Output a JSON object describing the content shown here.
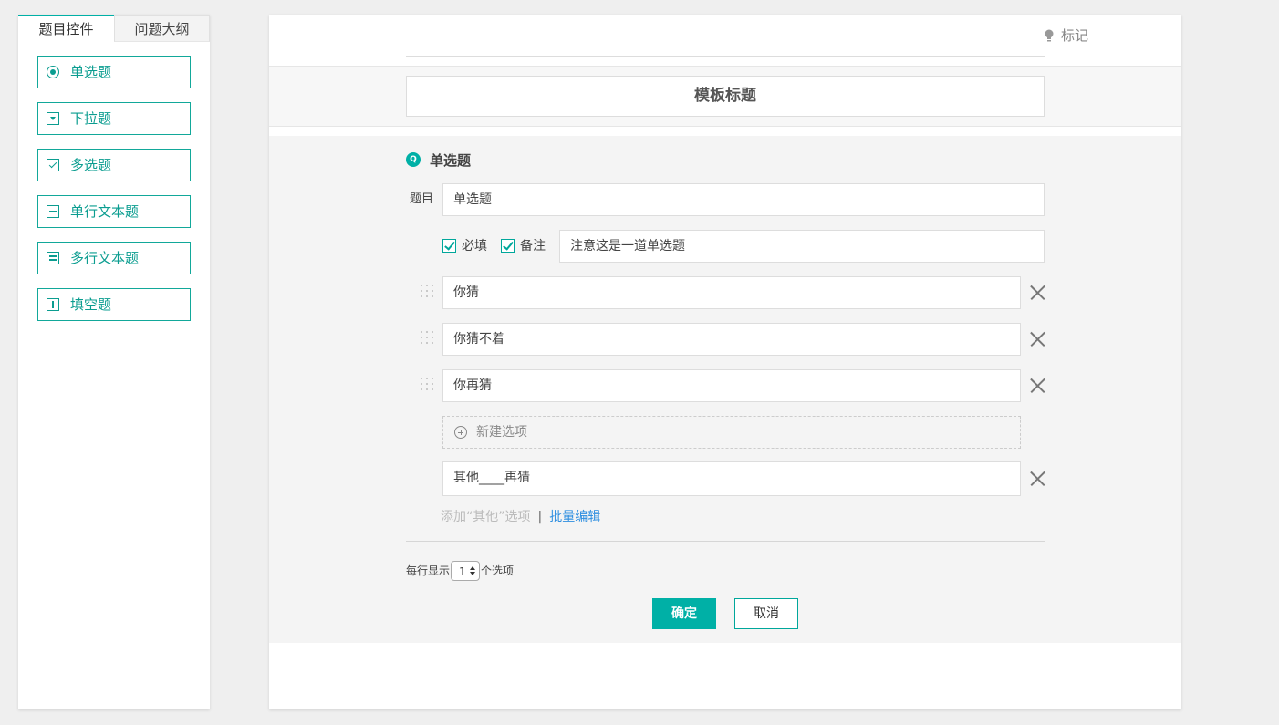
{
  "left_panel": {
    "tabs": [
      {
        "label": "题目控件",
        "active": true
      },
      {
        "label": "问题大纲",
        "active": false
      }
    ],
    "controls": [
      {
        "label": "单选题",
        "icon": "radio-icon"
      },
      {
        "label": "下拉题",
        "icon": "dropdown-icon"
      },
      {
        "label": "多选题",
        "icon": "checkbox-icon"
      },
      {
        "label": "单行文本题",
        "icon": "single-line-text-icon"
      },
      {
        "label": "多行文本题",
        "icon": "multi-line-text-icon"
      },
      {
        "label": "填空题",
        "icon": "fill-blank-icon"
      }
    ]
  },
  "main": {
    "mark": {
      "label": "标记",
      "icon": "lightbulb-icon"
    },
    "template_title": "模板标题",
    "question": {
      "icon_text": "Q",
      "type_label": "单选题",
      "field_label": "题目",
      "title_value": "单选题",
      "required_label": "必填",
      "required_checked": true,
      "note_label": "备注",
      "note_checked": true,
      "note_value": "注意这是一道单选题",
      "options": [
        "你猜",
        "你猜不着",
        "你再猜"
      ],
      "new_option_label": "新建选项",
      "other_option": "其他____再猜",
      "add_other_label": "添加“其他”选项",
      "separator": "|",
      "batch_edit_label": "批量编辑",
      "per_row_prefix": "每行显示",
      "per_row_value": "1",
      "per_row_suffix": "个选项",
      "confirm_label": "确定",
      "cancel_label": "取消"
    }
  },
  "colors": {
    "accent": "#00b0a6",
    "link": "#2f8fe0",
    "background": "#efefef"
  }
}
